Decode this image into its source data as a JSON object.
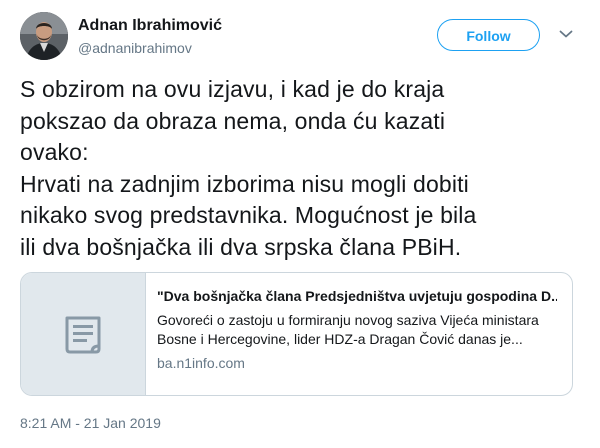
{
  "author": {
    "name": "Adnan Ibrahimović",
    "handle": "@adnanibrahimov"
  },
  "follow_button": {
    "label": "Follow"
  },
  "menu": {
    "icon": "chevron-down-icon"
  },
  "tweet": {
    "lines": [
      "S obzirom na ovu izjavu, i kad je do kraja",
      "pokszao da obraza nema, onda ću kazati",
      "ovako:",
      "Hrvati na zadnjim izborima nisu mogli dobiti",
      "nikako svog predstavnika. Mogućnost je bila",
      "ili dva bošnjačka ili dva srpska člana PBiH."
    ]
  },
  "card": {
    "icon": "document-icon",
    "title": "\"Dva bošnjačka člana Predsjedništva uvjetuju gospodina D...",
    "description_lines": [
      "Govoreći o zastoju u formiranju novog saziva Vijeća ministara",
      "Bosne i Hercegovine, lider HDZ-a Dragan Čović danas je..."
    ],
    "domain": "ba.n1info.com"
  },
  "timestamp": "8:21 AM - 21 Jan 2019",
  "colors": {
    "accent": "#1da1f2",
    "text": "#14171a",
    "secondary_text": "#657786",
    "card_border": "#ccd6dd",
    "card_media_bg": "#e1e8ed"
  }
}
